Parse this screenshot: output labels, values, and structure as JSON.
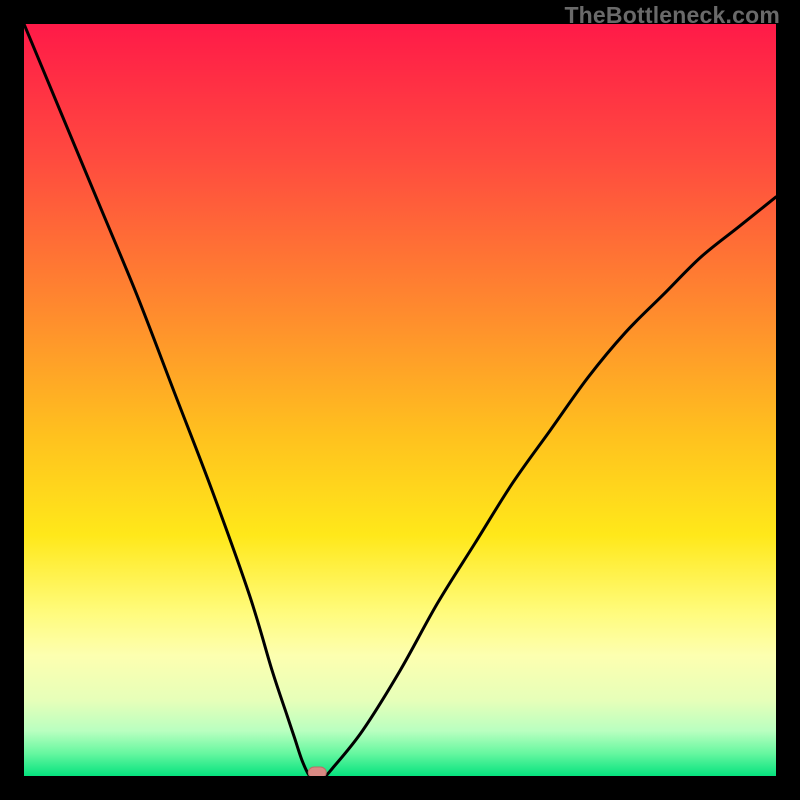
{
  "watermark": "TheBottleneck.com",
  "chart_data": {
    "type": "line",
    "title": "",
    "xlabel": "",
    "ylabel": "",
    "xlim": [
      0,
      100
    ],
    "ylim": [
      0,
      100
    ],
    "series": [
      {
        "name": "curve",
        "x": [
          0,
          5,
          10,
          15,
          20,
          25,
          30,
          33,
          35,
          36,
          37,
          38,
          39,
          40,
          41,
          45,
          50,
          55,
          60,
          65,
          70,
          75,
          80,
          85,
          90,
          95,
          100
        ],
        "y": [
          100,
          88,
          76,
          64,
          51,
          38,
          24,
          14,
          8,
          5,
          2,
          0,
          0,
          0,
          1,
          6,
          14,
          23,
          31,
          39,
          46,
          53,
          59,
          64,
          69,
          73,
          77
        ]
      }
    ],
    "marker": {
      "x": 39,
      "y": 0
    }
  },
  "colors": {
    "curve": "#000000",
    "marker_fill": "#d98a84",
    "marker_stroke": "#b96e68"
  }
}
